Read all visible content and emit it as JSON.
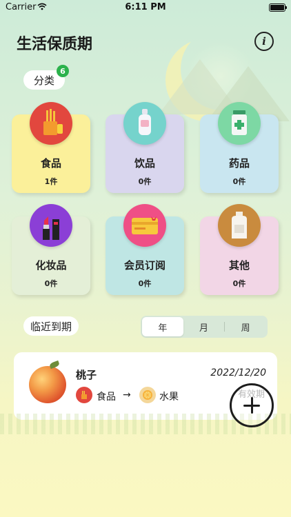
{
  "status_bar": {
    "carrier": "Carrier",
    "time": "6:11 PM"
  },
  "header": {
    "title": "生活保质期",
    "info_icon": "info-icon"
  },
  "category_section": {
    "label": "分类",
    "badge_count": "6"
  },
  "categories": [
    {
      "label": "食品",
      "count": "1件",
      "bg": "#fbf09a",
      "icon_bg": "#e2473e",
      "icon": "fries-icon"
    },
    {
      "label": "饮品",
      "count": "0件",
      "bg": "#d9d6ee",
      "icon_bg": "#75d3cc",
      "icon": "bottle-icon"
    },
    {
      "label": "药品",
      "count": "0件",
      "bg": "#c9e6f0",
      "icon_bg": "#7dd8a4",
      "icon": "medicine-icon"
    },
    {
      "label": "化妆品",
      "count": "0件",
      "bg": "#e4efd7",
      "icon_bg": "#8b3fd6",
      "icon": "lipstick-icon"
    },
    {
      "label": "会员订阅",
      "count": "0件",
      "bg": "#bfe6e4",
      "icon_bg": "#ef4f86",
      "icon": "gift-card-icon"
    },
    {
      "label": "其他",
      "count": "0件",
      "bg": "#f2d6e6",
      "icon_bg": "#c98b3e",
      "icon": "jug-icon"
    }
  ],
  "upcoming": {
    "label": "临近到期",
    "tabs": [
      "年",
      "月",
      "周"
    ],
    "active_tab": 0
  },
  "items": [
    {
      "name": "桃子",
      "date": "2022/12/20",
      "category": "食品",
      "arrow": "→",
      "subcategory": "水果",
      "expiry_label": "有效期"
    }
  ],
  "colors": {
    "accent_green": "#2bb24c",
    "card_white": "#ffffff"
  }
}
